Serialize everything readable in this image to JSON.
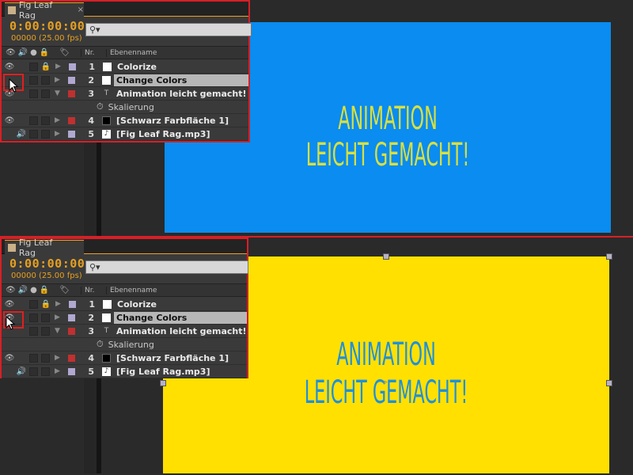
{
  "comp_name": "Fig Leaf Rag",
  "timecode": "0:00:00:00",
  "fps_label": "00000 (25.00 fps)",
  "search_placeholder": "",
  "columns": {
    "nr": "Nr.",
    "name": "Ebenenname"
  },
  "layers": [
    {
      "num": "1",
      "name": "Colorize",
      "label_color": "#b0a8d0",
      "type_color": "#ffffff"
    },
    {
      "num": "2",
      "name": "Change Colors",
      "label_color": "#b0a8d0",
      "type_color": "#ffffff"
    },
    {
      "num": "3",
      "name": "Animation leicht gemacht!",
      "label_color": "#c03030",
      "type_icon": "T"
    },
    {
      "sub": "Skalierung"
    },
    {
      "num": "4",
      "name": "[Schwarz Farbfläche 1]",
      "label_color": "#c03030",
      "type_color": "#000000"
    },
    {
      "num": "5",
      "name": "[Fig Leaf Rag.mp3]",
      "label_color": "#b0a8d0",
      "type_icon": "♪"
    }
  ],
  "top_comp": {
    "background": "#0a8cf0",
    "text_color": "#d8e040",
    "line1": "ANIMATION",
    "line2": "LEICHT GEMACHT!"
  },
  "bottom_comp": {
    "background": "#ffe000",
    "text_color": "#2090d8",
    "line1": "ANIMATION",
    "line2": "LEICHT GEMACHT!"
  }
}
